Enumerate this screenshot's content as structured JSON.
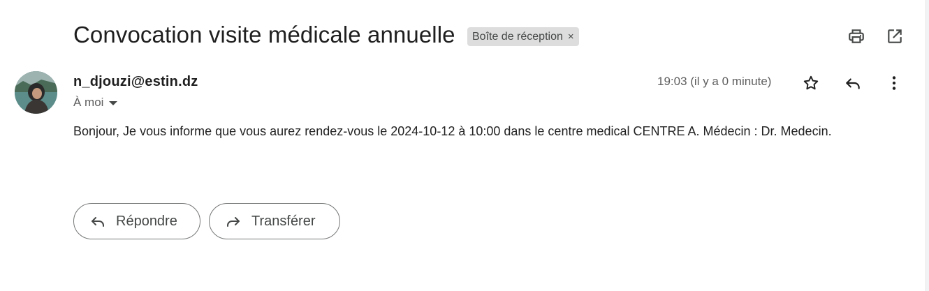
{
  "email": {
    "subject": "Convocation visite médicale annuelle",
    "label": "Boîte de réception",
    "label_remove": "×",
    "sender": "n_djouzi@estin.dz",
    "recipients": "À moi",
    "timestamp": "19:03 (il y a 0 minute)",
    "body": "Bonjour, Je vous informe que vous aurez rendez-vous le 2024-10-12 à 10:00 dans le centre medical CENTRE A. Médecin : Dr. Medecin."
  },
  "actions": {
    "reply_label": "Répondre",
    "forward_label": "Transférer"
  },
  "icons": {
    "print": "print-icon",
    "open_new_window": "open-in-new-icon",
    "star": "star-outline-icon",
    "reply": "reply-icon",
    "more": "more-vert-icon",
    "forward": "forward-icon"
  },
  "colors": {
    "text": "#1f1f1f",
    "secondary_text": "#5e5e5e",
    "chip_bg": "#dddddd",
    "button_border": "#747775"
  }
}
